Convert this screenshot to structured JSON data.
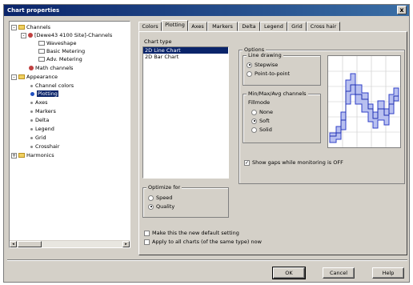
{
  "window": {
    "title": "Chart properties",
    "close_glyph": "x"
  },
  "tree": {
    "items": [
      {
        "label": "Channels",
        "icon": "folder-icon"
      },
      {
        "label": "[Dewe43 4100 Site]-Channels",
        "icon": "channel-icon"
      },
      {
        "label": "Waveshape",
        "icon": "document-icon"
      },
      {
        "label": "Basic Metering",
        "icon": "document-icon"
      },
      {
        "label": "Adv. Metering",
        "icon": "document-icon"
      },
      {
        "label": "Math channels",
        "icon": "channel-icon"
      },
      {
        "label": "Appearance",
        "icon": "folder-icon"
      },
      {
        "label": "Channel colors",
        "icon": "bullet-icon"
      },
      {
        "label": "Plotting",
        "icon": "bullet-icon"
      },
      {
        "label": "Axes",
        "icon": "bullet-icon"
      },
      {
        "label": "Markers",
        "icon": "bullet-icon"
      },
      {
        "label": "Delta",
        "icon": "bullet-icon"
      },
      {
        "label": "Legend",
        "icon": "bullet-icon"
      },
      {
        "label": "Grid",
        "icon": "bullet-icon"
      },
      {
        "label": "Crosshair",
        "icon": "bullet-icon"
      },
      {
        "label": "Harmonics",
        "icon": "folder-icon"
      }
    ],
    "expand_minus": "-",
    "expand_plus": "+",
    "scroll_left": "◂",
    "scroll_right": "▸"
  },
  "tabs": [
    "Colors",
    "Plotting",
    "Axes",
    "Markers",
    "Delta",
    "Legend",
    "Grid",
    "Cross hair"
  ],
  "active_tab": "Plotting",
  "chart_type": {
    "title": "Chart type",
    "options": [
      "2D Line Chart",
      "2D Bar Chart"
    ],
    "selected": "2D Line Chart"
  },
  "optimize": {
    "title": "Optimize for",
    "options": [
      "Speed",
      "Quality"
    ],
    "selected": "Quality"
  },
  "options_group": {
    "title": "Options",
    "line_drawing": {
      "title": "Line drawing",
      "options": [
        "Stepwise",
        "Point-to-point"
      ],
      "selected": "Stepwise"
    },
    "minmax": {
      "title": "Min/Max/Avg channels",
      "subtitle": "Fillmode",
      "options": [
        "None",
        "Soft",
        "Solid"
      ],
      "selected": "Soft"
    },
    "show_gaps": {
      "label": "Show gaps while monitoring is OFF",
      "checked": true
    }
  },
  "footer_checks": [
    {
      "label": "Make this the new default setting",
      "checked": false
    },
    {
      "label": "Apply to all charts (of the same type) now",
      "checked": false
    }
  ],
  "buttons": {
    "ok": "OK",
    "cancel": "Cancel",
    "help": "Help"
  },
  "colors": {
    "titlebar": "#0a246a",
    "selection": "#0a246a",
    "preview_line": "#3040c8",
    "preview_fill": "#b8c0f0"
  }
}
